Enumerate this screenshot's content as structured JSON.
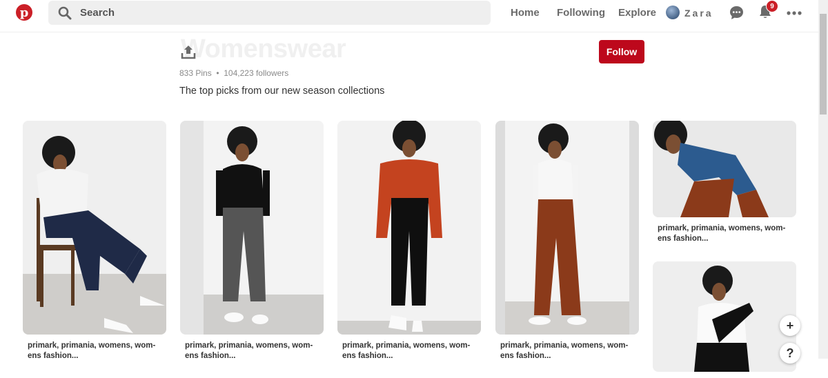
{
  "header": {
    "logo_letter": "p",
    "search_placeholder": "Search",
    "nav": [
      "Home",
      "Following",
      "Explore"
    ],
    "username": "Zara",
    "notification_count": "9"
  },
  "board": {
    "title": "Womenswear",
    "stats": "833 Pins  •  104,223 followers",
    "description": "The top picks from our new season collections",
    "follow_label": "Follow"
  },
  "pins": [
    {
      "caption": "primark, primania, womens, wom-ens fashion...",
      "top": "white knit sweater",
      "bottom": "navy pinstripe culottes"
    },
    {
      "caption": "primark, primania, womens, wom-ens fashion...",
      "top": "black turtleneck",
      "bottom": "grey trousers"
    },
    {
      "caption": "primark, primania, womens, wom-ens fashion...",
      "top": "orange sweatshirt",
      "bottom": "black paperbag trousers"
    },
    {
      "caption": "primark, primania, womens, wom-ens fashion...",
      "top": "white turtleneck",
      "bottom": "rust wide-leg trousers"
    },
    {
      "caption": "primark, primania, womens, wom-ens fashion...",
      "top": "denim jacket",
      "bottom": "rust wide-leg trousers"
    },
    {
      "caption": "",
      "top": "white t-shirt",
      "bottom": "black trousers"
    }
  ],
  "fab": {
    "add": "+",
    "help": "?"
  },
  "colors": {
    "brand_red": "#bd081c",
    "logo_red": "#cb1f27",
    "muted_text": "#6a6a6a"
  }
}
